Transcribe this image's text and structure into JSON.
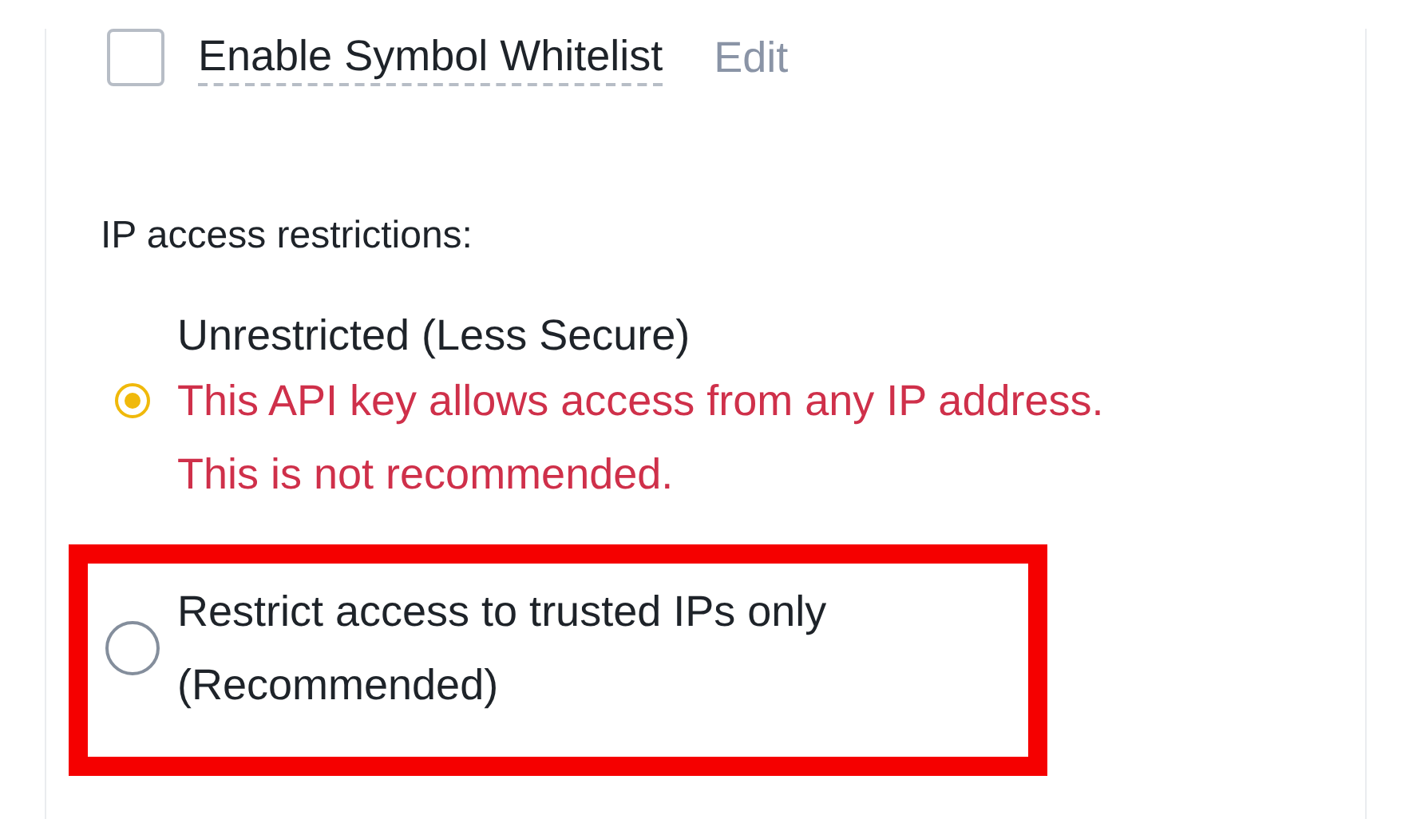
{
  "whitelist": {
    "label": "Enable Symbol Whitelist",
    "checked": false,
    "edit": "Edit"
  },
  "ip_section": {
    "title": "IP access restrictions:",
    "options": [
      {
        "label": "Unrestricted (Less Secure)",
        "selected": true,
        "warning": [
          "This API key allows access from any IP address.",
          "This is not recommended."
        ]
      },
      {
        "label": "Restrict access to trusted IPs only",
        "note": "(Recommended)",
        "selected": false,
        "highlighted": true
      }
    ]
  }
}
